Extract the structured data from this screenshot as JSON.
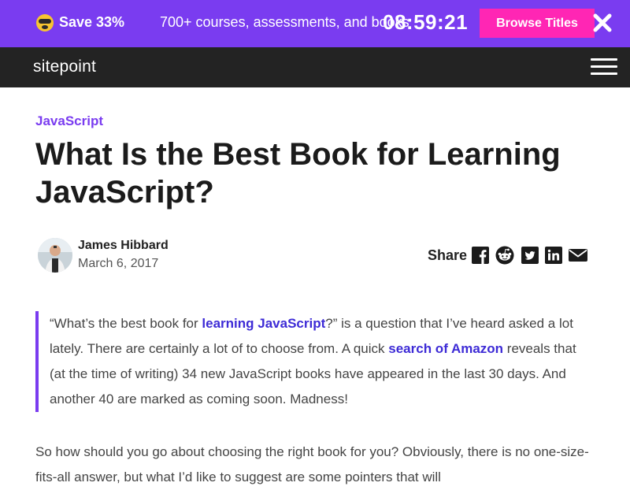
{
  "promo": {
    "save_text": "Save 33%",
    "description": "700+ courses, assessments, and books",
    "countdown": "08:59:21",
    "button_label": "Browse Titles"
  },
  "nav": {
    "logo_text": "sitepoint"
  },
  "article": {
    "category": "JavaScript",
    "title": "What Is the Best Book for Learning JavaScript?",
    "author": {
      "name": "James Hibbard",
      "date": "March 6, 2017"
    },
    "share_label": "Share",
    "share_icons": [
      "facebook-icon",
      "reddit-icon",
      "twitter-icon",
      "linkedin-icon",
      "email-icon"
    ],
    "intro": {
      "part1": "“What’s the best book for ",
      "link1": "learning JavaScript",
      "part2": "?” is a question that I’ve heard asked a lot lately. There are certainly a lot of to choose from. A quick ",
      "link2": "search of Amazon",
      "part3": " reveals that (at the time of writing) 34 new JavaScript books have appeared in the last 30 days. And another 40 are marked as coming soon. Madness!"
    },
    "paragraph": "So how should you go about choosing the right book for you? Obviously, there is no one-size-fits-all answer, but what I’d like to suggest are some pointers that will"
  },
  "colors": {
    "promo_bg": "#7a3cf0",
    "button_bg": "#ff26b4",
    "nav_bg": "#232323",
    "accent": "#7a3cf0",
    "link": "#3d2bd6"
  }
}
